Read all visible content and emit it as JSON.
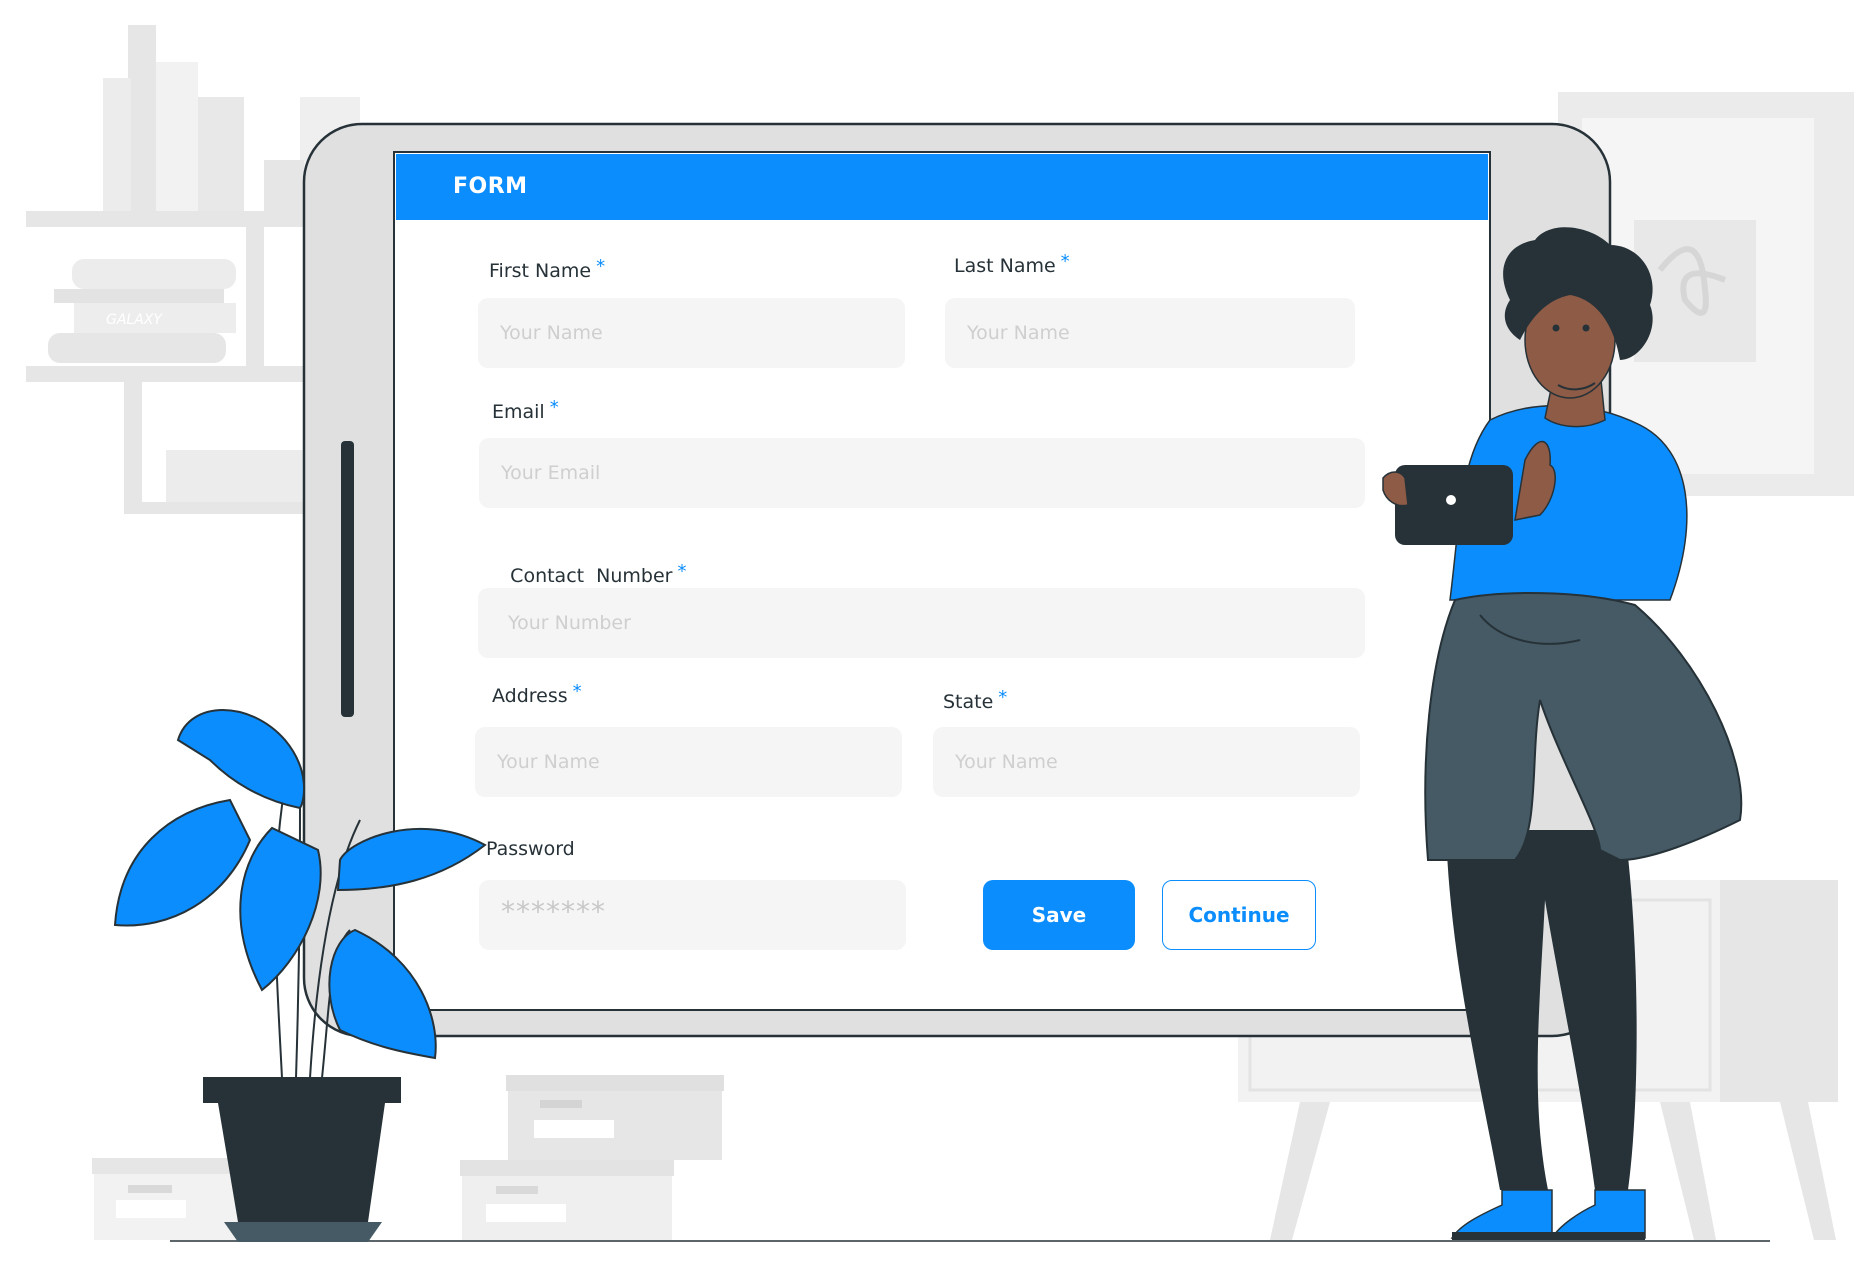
{
  "form": {
    "title": "FORM",
    "required_marker": "*",
    "fields": {
      "first_name": {
        "label": "First Name",
        "placeholder": "Your Name"
      },
      "last_name": {
        "label": "Last Name",
        "placeholder": "Your Name"
      },
      "email": {
        "label": "Email",
        "placeholder": "Your Email"
      },
      "contact_number": {
        "label": "Contact  Number",
        "placeholder": "Your Number"
      },
      "address": {
        "label": "Address",
        "placeholder": "Your Name"
      },
      "state": {
        "label": "State",
        "placeholder": "Your Name"
      },
      "password": {
        "label": "Password",
        "placeholder": "*******"
      }
    },
    "buttons": {
      "save": "Save",
      "continue": "Continue"
    }
  },
  "decor": {
    "book_spine_text": "GALAXY"
  },
  "colors": {
    "accent": "#0b8dfd",
    "dark": "#263238",
    "jacket": "#455a64",
    "skin": "#8d5b46",
    "background_gray": "#ebebeb"
  }
}
